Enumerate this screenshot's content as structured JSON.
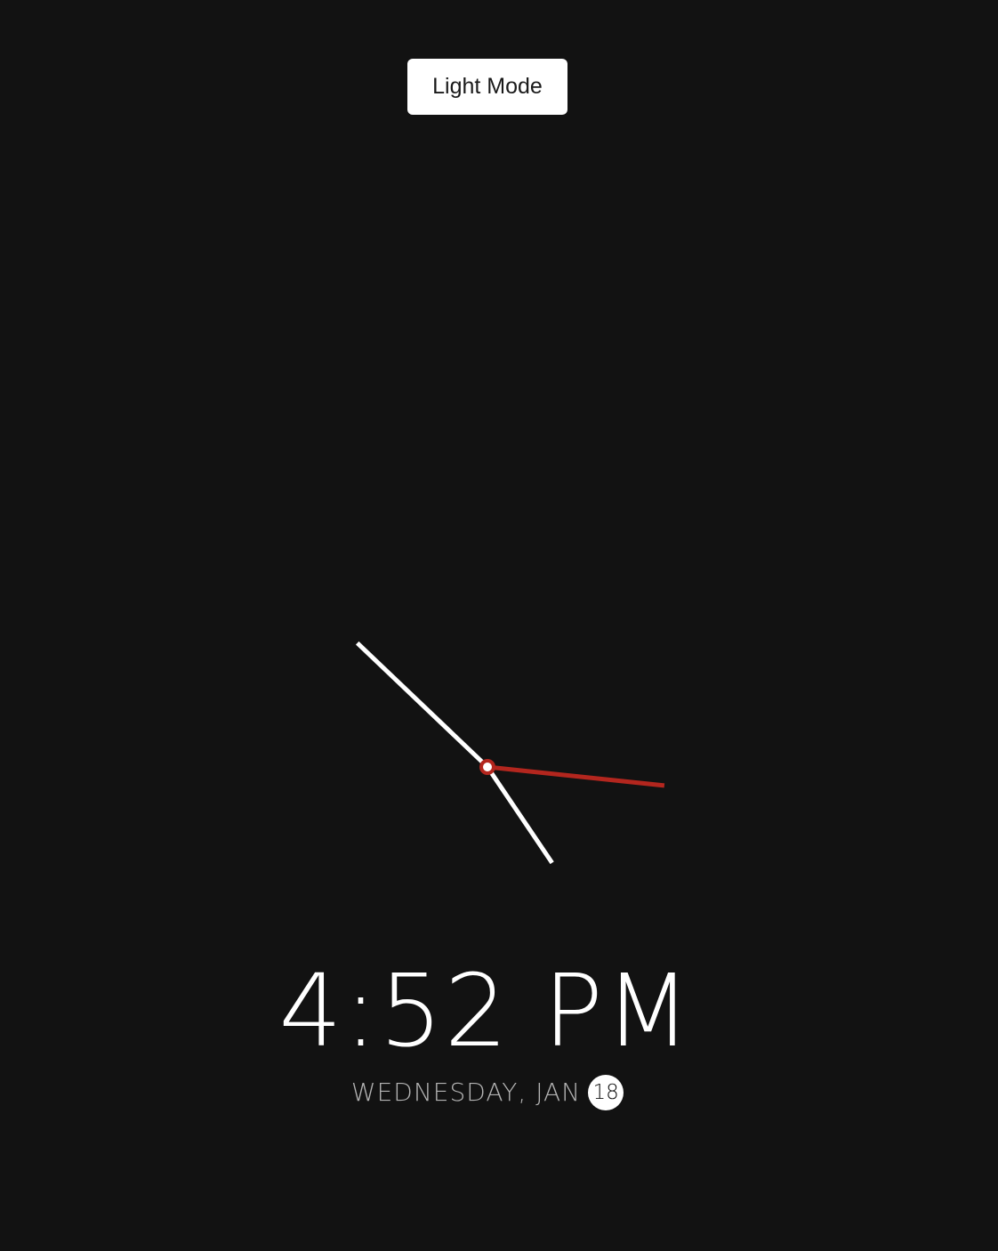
{
  "theme_toggle": {
    "label": "Light Mode"
  },
  "clock": {
    "hour": 4,
    "minute": 52,
    "second": 16,
    "colors": {
      "hands": "#ffffff",
      "second_hand": "#b3261e",
      "background": "#121212"
    }
  },
  "time": {
    "display": "4:52 PM"
  },
  "date": {
    "weekday_month": "WEDNESDAY, JAN",
    "day": "18"
  }
}
